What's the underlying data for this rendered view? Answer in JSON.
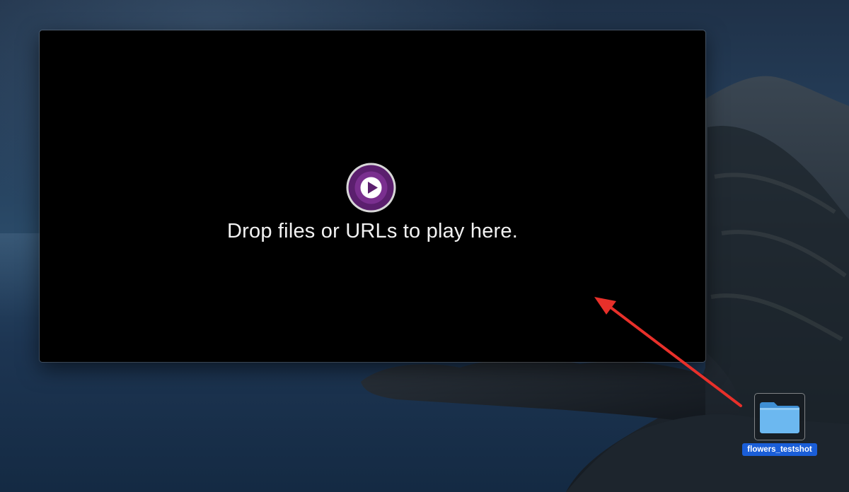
{
  "player": {
    "placeholder_text": "Drop files or URLs to play here.",
    "logo_icon": "play-logo-icon",
    "logo_colors": {
      "ring": "#d8d8d8",
      "outer": "#5b1f6e",
      "inner": "#7a2f8f",
      "play": "#ffffff"
    }
  },
  "desktop": {
    "folder": {
      "label": "flowers_testshot",
      "icon": "folder-icon",
      "color": "#5aa8e6"
    }
  },
  "annotation": {
    "arrow_color": "#e8302a"
  }
}
